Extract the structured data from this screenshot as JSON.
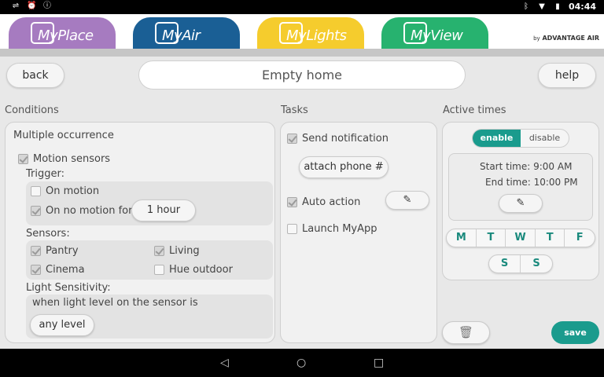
{
  "status_bar": {
    "time": "04:44",
    "icons_left": [
      "usb-icon",
      "alarm-icon",
      "info-icon"
    ],
    "icons_right": [
      "bluetooth-icon",
      "wifi-icon",
      "battery-icon"
    ]
  },
  "tabs": [
    {
      "label": "MyPlace",
      "prefix": "My",
      "suffix": "Place",
      "color": "#a67bc0"
    },
    {
      "label": "MyAir",
      "prefix": "My",
      "suffix": "Air",
      "color": "#1a5f95"
    },
    {
      "label": "MyLights",
      "prefix": "My",
      "suffix": "Lights",
      "color": "#f5cc2d"
    },
    {
      "label": "MyView",
      "prefix": "My",
      "suffix": "View",
      "color": "#27b26f"
    }
  ],
  "brand": {
    "by": "by",
    "name": "ADVANTAGE AIR"
  },
  "toolbar": {
    "back_label": "back",
    "help_label": "help",
    "name_value": "Empty home"
  },
  "conditions": {
    "title": "Conditions",
    "heading": "Multiple occurrence",
    "motion_sensors": {
      "label": "Motion sensors",
      "checked": true
    },
    "trigger_label": "Trigger:",
    "on_motion": {
      "label": "On motion",
      "checked": false
    },
    "on_no_motion": {
      "label": "On no motion for",
      "checked": true,
      "duration": "1 hour"
    },
    "sensors_label": "Sensors:",
    "sensors": [
      {
        "label": "Pantry",
        "checked": true
      },
      {
        "label": "Living",
        "checked": true
      },
      {
        "label": "Cinema",
        "checked": true
      },
      {
        "label": "Hue outdoor",
        "checked": false
      }
    ],
    "light_label": "Light Sensitivity:",
    "light_text": "when light level on the sensor is",
    "light_value": "any level"
  },
  "tasks": {
    "title": "Tasks",
    "send_notification": {
      "label": "Send notification",
      "checked": true
    },
    "attach_phone_label": "attach phone #",
    "auto_action": {
      "label": "Auto action",
      "checked": true
    },
    "launch_myapp": {
      "label": "Launch MyApp",
      "checked": false
    }
  },
  "active_times": {
    "title": "Active times",
    "enable_label": "enable",
    "disable_label": "disable",
    "start_time": "Start time: 9:00 AM",
    "end_time": "End time: 10:00 PM",
    "weekdays": [
      "M",
      "T",
      "W",
      "T",
      "F"
    ],
    "weekend": [
      "S",
      "S"
    ],
    "save_label": "save"
  },
  "colors": {
    "accent": "#1a9b8d"
  }
}
